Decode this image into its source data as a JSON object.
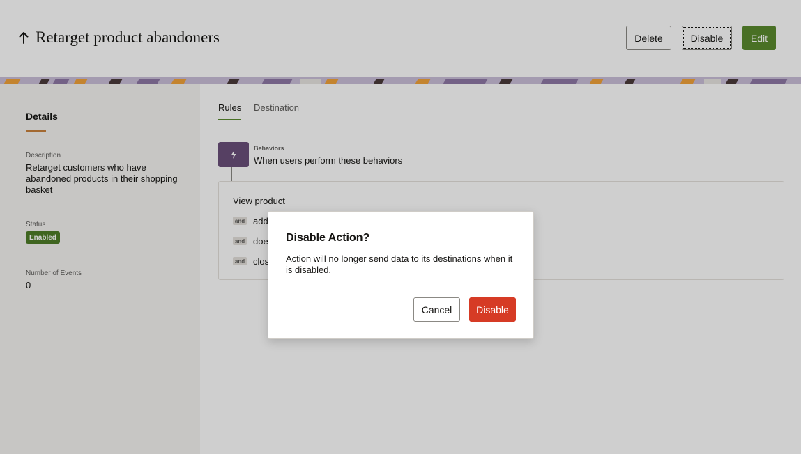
{
  "header": {
    "title": "Retarget product abandoners",
    "back_icon": "arrow-up-icon",
    "buttons": {
      "delete": "Delete",
      "disable": "Disable",
      "edit": "Edit"
    }
  },
  "sidebar": {
    "tab": "Details",
    "description_label": "Description",
    "description_value": "Retarget customers who have abandoned products in their shopping basket",
    "status_label": "Status",
    "status_value": "Enabled",
    "events_label": "Number of Events",
    "events_value": "0"
  },
  "main": {
    "tabs": [
      {
        "label": "Rules",
        "selected": true
      },
      {
        "label": "Destination",
        "selected": false
      }
    ],
    "behaviors": {
      "icon": "lightning-icon",
      "title": "Behaviors",
      "subtitle": "When users perform these behaviors"
    },
    "rules": {
      "head": "View product",
      "rows": [
        {
          "chip": "and",
          "text": "add"
        },
        {
          "chip": "and",
          "text": "doe"
        },
        {
          "chip": "and",
          "text": "clos"
        }
      ]
    }
  },
  "dialog": {
    "title": "Disable Action?",
    "body": "Action will no longer send data to its destinations when it is disabled.",
    "cancel": "Cancel",
    "confirm": "Disable"
  },
  "colors": {
    "edit_button": "#5a8a2e",
    "status_badge": "#4e7d28",
    "destructive": "#d63b25",
    "behaviors_icon_bg": "#6b4f7a",
    "details_accent": "#c9823d"
  }
}
